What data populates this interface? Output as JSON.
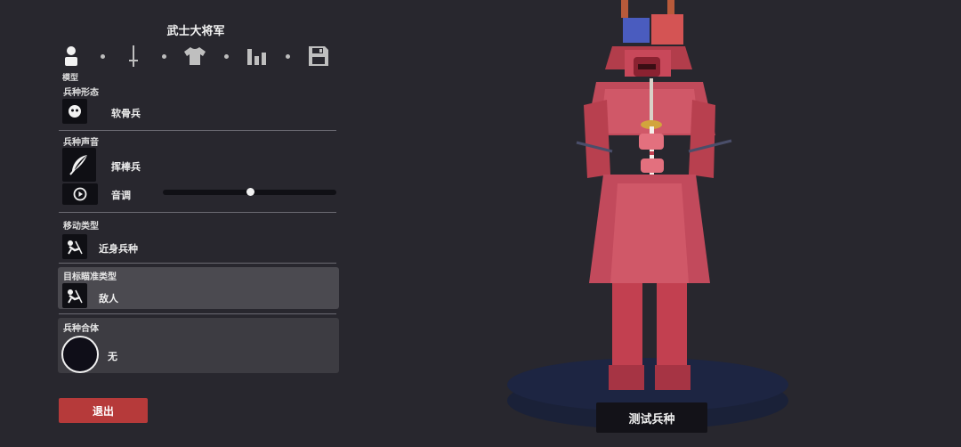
{
  "header": {
    "title": "武士大将军"
  },
  "toolbar": {
    "items": [
      {
        "icon": "person-icon",
        "label": "模型"
      },
      {
        "icon": "sword-icon"
      },
      {
        "icon": "shirt-icon"
      },
      {
        "icon": "stats-icon"
      },
      {
        "icon": "save-icon"
      }
    ]
  },
  "sections": {
    "unit_form": {
      "label": "兵种形态",
      "value": "软骨兵"
    },
    "unit_voice": {
      "label": "兵种声音",
      "value": "挥棒兵",
      "pitch_label": "音调",
      "pitch_level": 0.5
    },
    "movement": {
      "label": "移动类型",
      "value": "近身兵种"
    },
    "targeting": {
      "label": "目标瞄准类型",
      "value": "敌人"
    },
    "combine": {
      "label": "兵种合体",
      "value": "无"
    }
  },
  "buttons": {
    "exit": "退出",
    "test": "测试兵种"
  },
  "colors": {
    "background": "#28272e",
    "exit_button": "#b63a3a",
    "highlight_panel": "#4b4a50",
    "armor": "#c8485a",
    "pedestal": "#1d2542",
    "flag_blue": "#4a5cbf",
    "flag_red": "#d45454"
  }
}
